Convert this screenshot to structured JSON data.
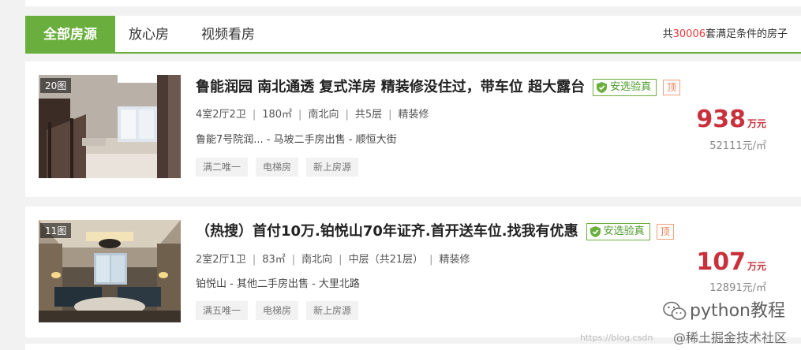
{
  "tabs": [
    {
      "label": "全部房源",
      "active": true
    },
    {
      "label": "放心房",
      "active": false
    },
    {
      "label": "视频看房",
      "active": false
    }
  ],
  "summary": {
    "prefix": "共",
    "count": "30006",
    "suffix": "套满足条件的房子"
  },
  "badges": {
    "safe": "安选验真",
    "top": "顶"
  },
  "listings": [
    {
      "photo_count": "20图",
      "title": "鲁能润园 南北通透 复式洋房 精装修没住过，带车位 超大露台",
      "layout": "4室2厅2卫",
      "area": "180㎡",
      "orientation": "南北向",
      "floor": "共5层",
      "decoration": "精装修",
      "location": "鲁能7号院润... - 马坡二手房出售 - 顺恒大街",
      "tags": [
        "满二唯一",
        "电梯房",
        "新上房源"
      ],
      "price": "938",
      "price_unit": "万元",
      "unit_price": "52111元/㎡"
    },
    {
      "photo_count": "11图",
      "title": "（热搜）首付10万.铂悦山70年证齐.首开送车位.找我有优惠",
      "layout": "2室2厅1卫",
      "area": "83㎡",
      "orientation": "南北向",
      "floor": "中层（共21层）",
      "decoration": "精装修",
      "location": "铂悦山 - 其他二手房出售 - 大里北路",
      "tags": [
        "满五唯一",
        "电梯房",
        "新上房源"
      ],
      "price": "107",
      "price_unit": "万元",
      "unit_price": "12891元/㎡"
    }
  ],
  "watermark": {
    "main": "python教程",
    "sub": "@稀土掘金技术社区",
    "url": "https://blog.csdn"
  },
  "colors": {
    "accent_green": "#6aaf3d",
    "price_red": "#c8303c",
    "count_red": "#e4393c",
    "top_orange": "#e97c4f"
  },
  "icons": {
    "safe": "shield-check-icon",
    "wechat": "wechat-icon"
  }
}
